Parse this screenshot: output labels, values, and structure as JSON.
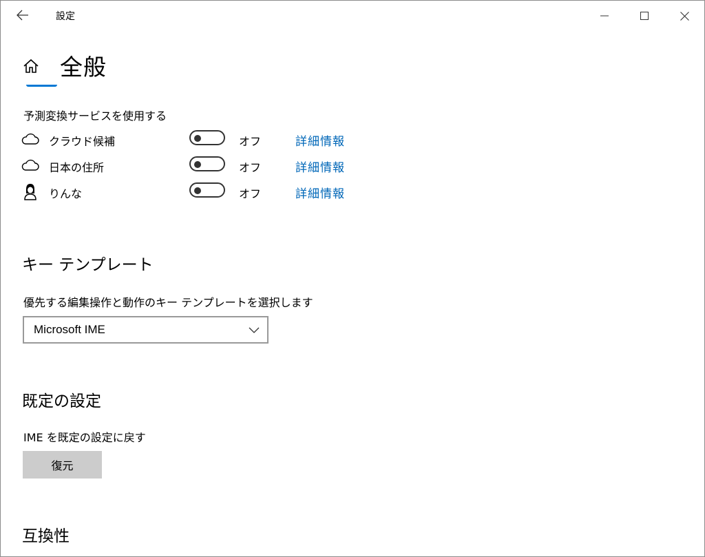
{
  "window": {
    "title": "設定",
    "controls": {
      "minimize": "minimize-icon",
      "maximize": "maximize-icon",
      "close": "close-icon"
    }
  },
  "header": {
    "title": "全般"
  },
  "prediction": {
    "label": "予測変換サービスを使用する",
    "items": [
      {
        "label": "クラウド候補",
        "icon": "cloud-icon",
        "state": "オフ",
        "link": "詳細情報"
      },
      {
        "label": "日本の住所",
        "icon": "cloud-icon",
        "state": "オフ",
        "link": "詳細情報"
      },
      {
        "label": "りんな",
        "icon": "rinna-icon",
        "state": "オフ",
        "link": "詳細情報"
      }
    ]
  },
  "key_template": {
    "heading": "キー テンプレート",
    "label": "優先する編集操作と動作のキー テンプレートを選択します",
    "selected": "Microsoft IME"
  },
  "defaults": {
    "heading": "既定の設定",
    "label": "IME を既定の設定に戻す",
    "button": "復元"
  },
  "compat": {
    "heading": "互換性"
  },
  "colors": {
    "accent": "#0078d4",
    "link": "#0067b8",
    "button_bg": "#cccccc"
  }
}
